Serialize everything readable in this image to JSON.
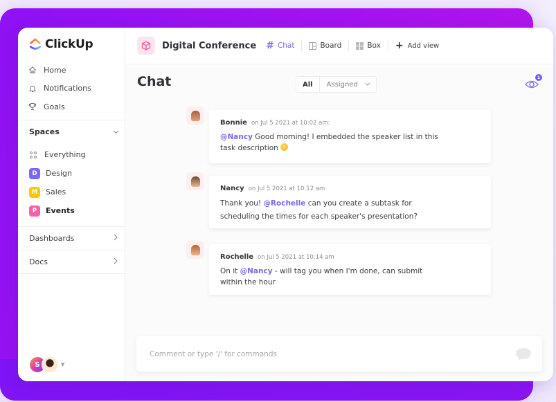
{
  "app": {
    "name": "ClickUp"
  },
  "colors": {
    "accent": "#7b68ee",
    "background_gradient": [
      "#8d12f4",
      "#b816e8"
    ]
  },
  "sidebar": {
    "nav": [
      {
        "label": "Home",
        "icon": "home-icon"
      },
      {
        "label": "Notifications",
        "icon": "bell-icon"
      },
      {
        "label": "Goals",
        "icon": "trophy-icon"
      }
    ],
    "spaces_label": "Spaces",
    "everything_label": "Everything",
    "spaces": [
      {
        "initial": "D",
        "label": "Design",
        "color": "#7b68ee"
      },
      {
        "initial": "M",
        "label": "Sales",
        "color": "#ffc800"
      },
      {
        "initial": "P",
        "label": "Events",
        "color": "#f562a9",
        "active": true
      }
    ],
    "dashboards_label": "Dashboards",
    "docs_label": "Docs",
    "user_initial": "S"
  },
  "header": {
    "project_title": "Digital Conference",
    "views": [
      {
        "label": "Chat",
        "icon": "hash-icon",
        "active": true
      },
      {
        "label": "Board",
        "icon": "board-icon"
      },
      {
        "label": "Box",
        "icon": "box-grid-icon"
      }
    ],
    "add_view_label": "Add view"
  },
  "chat": {
    "title": "Chat",
    "filters": {
      "all": "All",
      "assigned": "Assigned"
    },
    "watchers_count": "1",
    "messages": [
      {
        "author": "Bonnie",
        "time": "on Jul 5 2021 at 10:02 am:",
        "mention": "@Nancy",
        "before": "",
        "after": " Good morning! I embedded the speaker list in this task description",
        "emoji": "slightly-smiling-face"
      },
      {
        "author": "Nancy",
        "time": "on Jul 5 2021 at 10:12 am",
        "before": "Thank you! ",
        "mention": "@Rochelle",
        "after": " can you create a subtask for scheduling the times for each speaker's presentation?"
      },
      {
        "author": "Rochelle",
        "time": "on Jul 5 2021 at 10:14 am",
        "before": "On it ",
        "mention": "@Nancy",
        "after": " - will tag you when I'm done, can submit within the hour"
      }
    ],
    "composer_placeholder": "Comment or type '/' for commands"
  }
}
